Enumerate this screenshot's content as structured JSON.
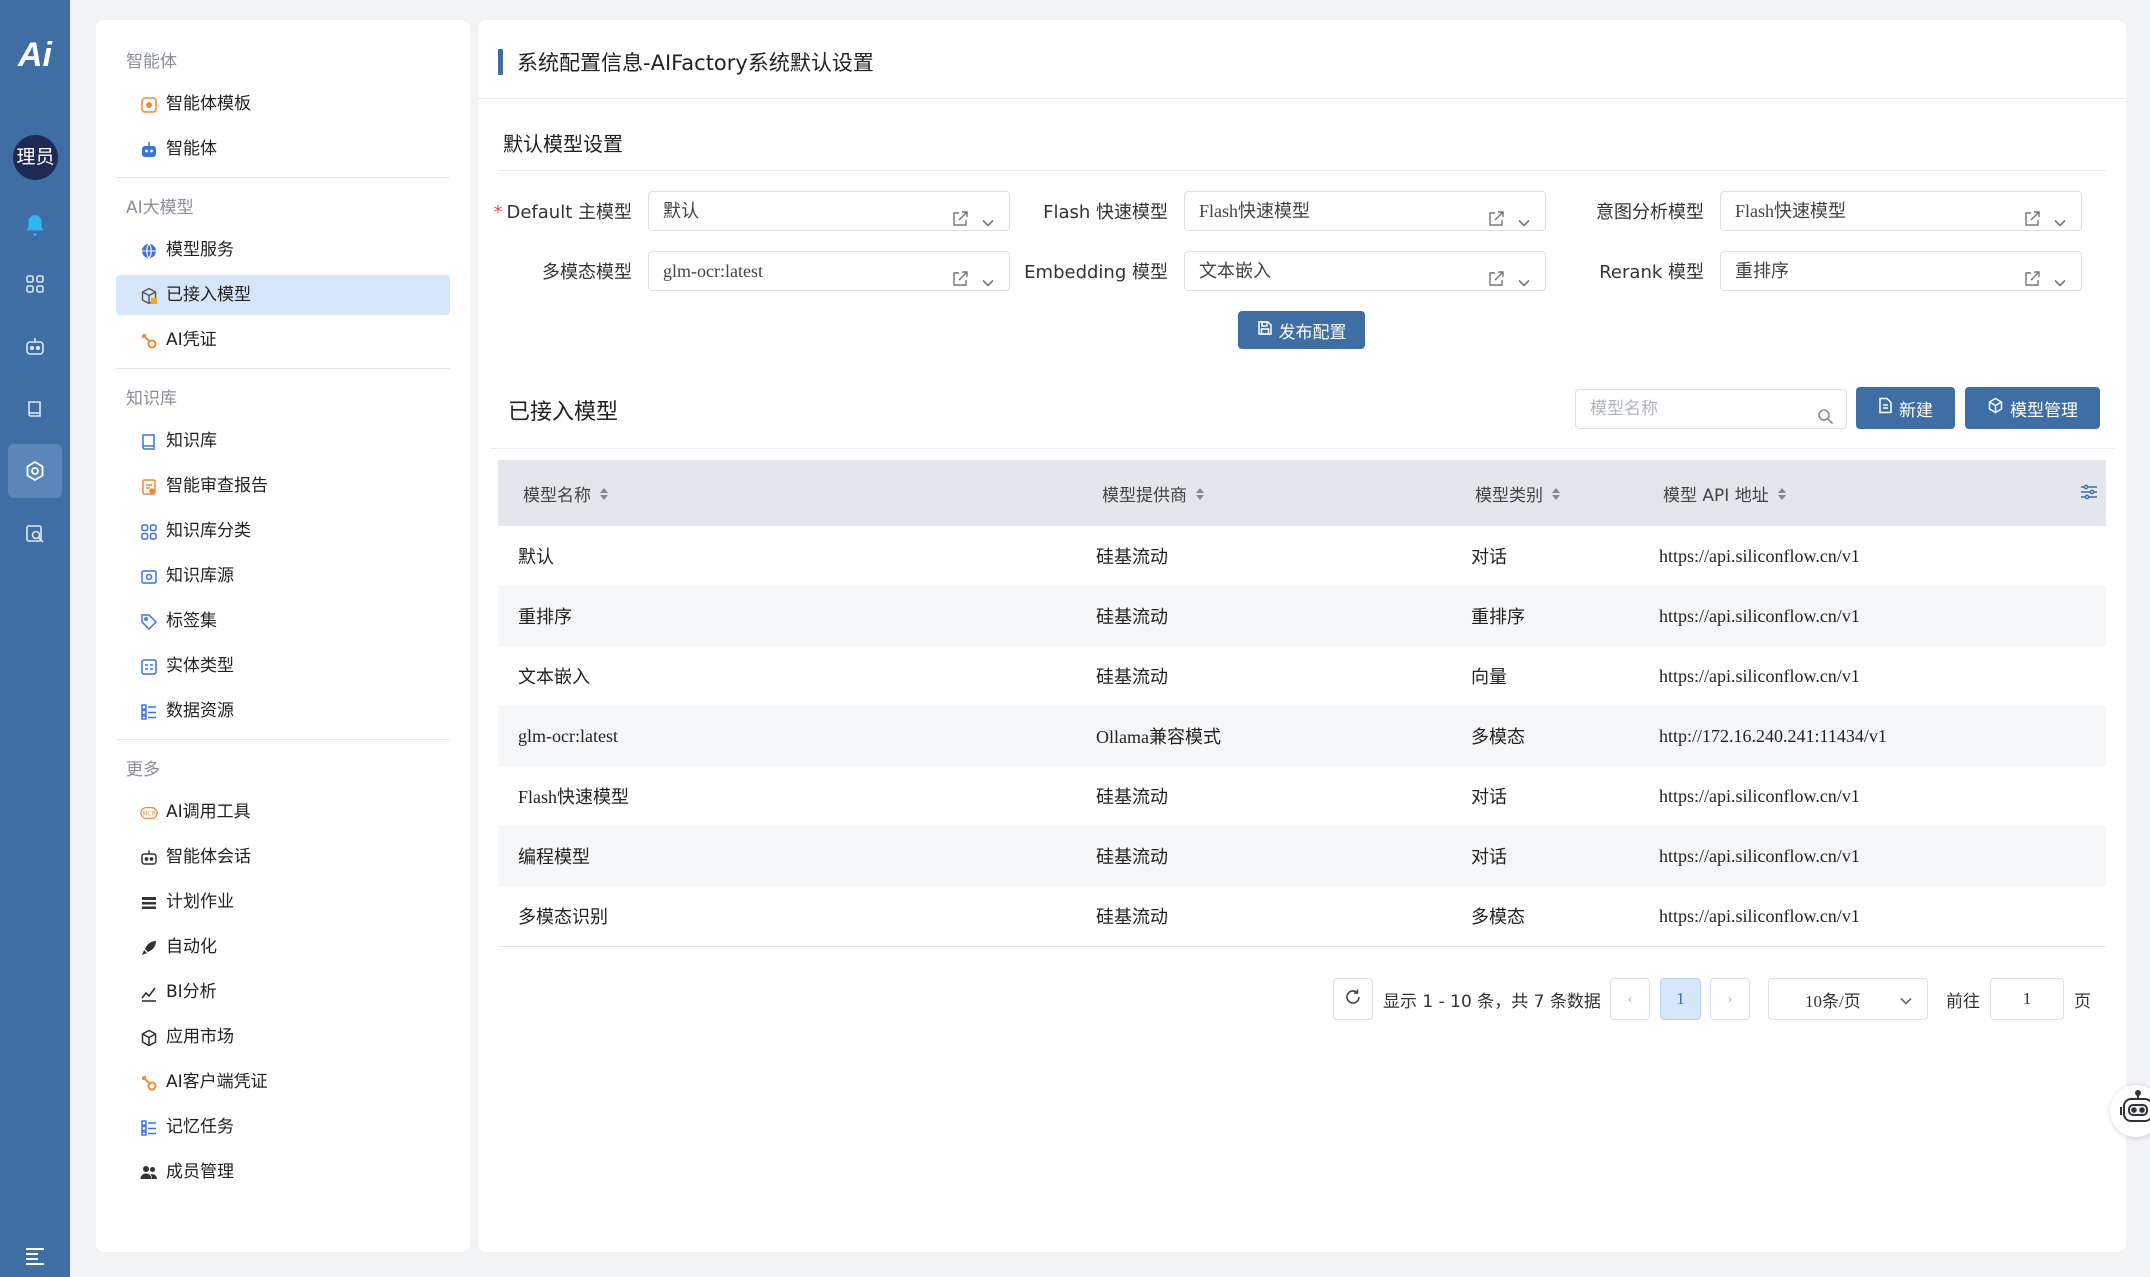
{
  "rail": {
    "logo": "Ai",
    "avatar_text": "理员",
    "icons": [
      "bell-icon",
      "apps-icon",
      "robot-chat-icon",
      "book-icon",
      "settings-icon",
      "search-report-icon",
      "menu-icon"
    ]
  },
  "sidenav": {
    "groups": [
      {
        "title": "智能体",
        "items": [
          {
            "label": "智能体模板",
            "icon": "template-icon"
          },
          {
            "label": "智能体",
            "icon": "robot-icon"
          }
        ]
      },
      {
        "title": "AI大模型",
        "items": [
          {
            "label": "模型服务",
            "icon": "globe-icon"
          },
          {
            "label": "已接入模型",
            "icon": "cube-icon",
            "active": true
          },
          {
            "label": "AI凭证",
            "icon": "key-icon"
          }
        ]
      },
      {
        "title": "知识库",
        "items": [
          {
            "label": "知识库",
            "icon": "book-icon"
          },
          {
            "label": "智能审查报告",
            "icon": "report-icon"
          },
          {
            "label": "知识库分类",
            "icon": "grid-icon"
          },
          {
            "label": "知识库源",
            "icon": "source-icon"
          },
          {
            "label": "标签集",
            "icon": "tag-icon"
          },
          {
            "label": "实体类型",
            "icon": "entity-icon"
          },
          {
            "label": "数据资源",
            "icon": "list-icon"
          }
        ]
      },
      {
        "title": "更多",
        "items": [
          {
            "label": "AI调用工具",
            "icon": "mcp-icon"
          },
          {
            "label": "智能体会话",
            "icon": "chat-robot-icon"
          },
          {
            "label": "计划作业",
            "icon": "schedule-icon"
          },
          {
            "label": "自动化",
            "icon": "rocket-icon"
          },
          {
            "label": "BI分析",
            "icon": "chart-icon"
          },
          {
            "label": "应用市场",
            "icon": "box-icon"
          },
          {
            "label": "AI客户端凭证",
            "icon": "key-icon"
          },
          {
            "label": "记忆任务",
            "icon": "list-icon"
          },
          {
            "label": "成员管理",
            "icon": "users-icon"
          }
        ]
      }
    ]
  },
  "page": {
    "title": "系统配置信息-AIFactory系统默认设置",
    "section_title": "默认模型设置",
    "fields": [
      {
        "label": "Default 主模型",
        "required": true,
        "value": "默认"
      },
      {
        "label": "Flash 快速模型",
        "required": false,
        "value": "Flash快速模型"
      },
      {
        "label": "意图分析模型",
        "required": false,
        "value": "Flash快速模型"
      },
      {
        "label": "多模态模型",
        "required": false,
        "value": "glm-ocr:latest"
      },
      {
        "label": "Embedding 模型",
        "required": false,
        "value": "文本嵌入"
      },
      {
        "label": "Rerank 模型",
        "required": false,
        "value": "重排序"
      }
    ],
    "publish_label": "发布配置",
    "list_title": "已接入模型",
    "search_placeholder": "模型名称",
    "new_label": "新建",
    "manage_label": "模型管理"
  },
  "table": {
    "columns": [
      "模型名称",
      "模型提供商",
      "模型类别",
      "模型 API 地址"
    ],
    "rows": [
      [
        "默认",
        "硅基流动",
        "对话",
        "https://api.siliconflow.cn/v1"
      ],
      [
        "重排序",
        "硅基流动",
        "重排序",
        "https://api.siliconflow.cn/v1"
      ],
      [
        "文本嵌入",
        "硅基流动",
        "向量",
        "https://api.siliconflow.cn/v1"
      ],
      [
        "glm-ocr:latest",
        "Ollama兼容模式",
        "多模态",
        "http://172.16.240.241:11434/v1"
      ],
      [
        "Flash快速模型",
        "硅基流动",
        "对话",
        "https://api.siliconflow.cn/v1"
      ],
      [
        "编程模型",
        "硅基流动",
        "对话",
        "https://api.siliconflow.cn/v1"
      ],
      [
        "多模态识别",
        "硅基流动",
        "多模态",
        "https://api.siliconflow.cn/v1"
      ]
    ]
  },
  "pagination": {
    "summary": "显示 1 - 10 条，共 7 条数据",
    "current_page": "1",
    "page_size": "10条/页",
    "goto_prefix": "前往",
    "goto_value": "1",
    "goto_suffix": "页",
    "prev": "‹",
    "next": "›"
  },
  "colors": {
    "accent": "#3f6ea5",
    "rail": "#3f6ea5",
    "active_bg": "#d5e6f8"
  }
}
